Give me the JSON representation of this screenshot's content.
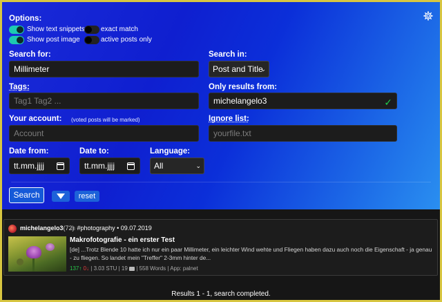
{
  "options": {
    "label": "Options:",
    "toggles": [
      {
        "label": "Show text snippets",
        "on": true
      },
      {
        "label": "exact match",
        "on": false
      },
      {
        "label": "Show post image",
        "on": true
      },
      {
        "label": "active posts only",
        "on": false
      }
    ]
  },
  "search_for": {
    "label": "Search for:",
    "value": "Millimeter"
  },
  "search_in": {
    "label": "Search in:",
    "value": "Post and Title"
  },
  "tags": {
    "label": "Tags:",
    "placeholder": "Tag1 Tag2 ..."
  },
  "only_results_from": {
    "label": "Only results from:",
    "value": "michelangelo3",
    "valid_mark": "✓"
  },
  "account": {
    "label": "Your account:",
    "note": "(voted posts will be marked)",
    "placeholder": "Account"
  },
  "ignore_list": {
    "label": "Ignore list:",
    "placeholder": "yourfile.txt"
  },
  "date_from": {
    "label": "Date from:",
    "value": "tt.mm.jjjj"
  },
  "date_to": {
    "label": "Date to:",
    "value": "tt.mm.jjjj"
  },
  "language": {
    "label": "Language:",
    "value": "All"
  },
  "actions": {
    "search": "Search",
    "reset": "reset"
  },
  "result": {
    "author": "michelangelo3",
    "reputation": "(72)",
    "in_word": "in",
    "tag": "#photography",
    "date": "• 09.07.2019",
    "title": "Makrofotografie - ein erster Test",
    "snippet": "[de] ...Trotz Blende 10 hatte ich nur ein paar Millimeter, ein leichter Wind wehte und Fliegen haben dazu auch noch die Eigenschaft - ja genau - zu fliegen. So landet mein \"Treffer\" 2-3mm hinter de...",
    "upvotes": "137↑",
    "downvotes": "0↓",
    "value": "| 3.03 STU |",
    "comments": "19",
    "words": "| 558 Words |",
    "app": "App: palnet"
  },
  "status": "Results 1 - 1, search completed.",
  "colors": {
    "accent_toggle": "#1ec9b0",
    "frame": "#d8c640",
    "valid": "#1fd04a"
  }
}
